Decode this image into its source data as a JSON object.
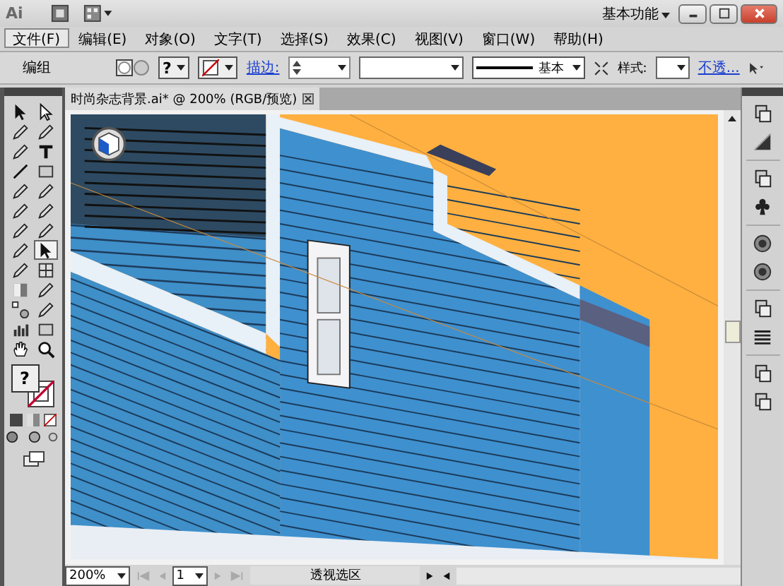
{
  "title_bar": {
    "app_logo": "Ai",
    "workspace": "基本功能"
  },
  "menu": [
    {
      "label": "文件(F)",
      "selected": true
    },
    {
      "label": "编辑(E)",
      "selected": false
    },
    {
      "label": "对象(O)",
      "selected": false
    },
    {
      "label": "文字(T)",
      "selected": false
    },
    {
      "label": "选择(S)",
      "selected": false
    },
    {
      "label": "效果(C)",
      "selected": false
    },
    {
      "label": "视图(V)",
      "selected": false
    },
    {
      "label": "窗口(W)",
      "selected": false
    },
    {
      "label": "帮助(H)",
      "selected": false
    }
  ],
  "control_bar": {
    "selection": "编组",
    "fill_symbol": "?",
    "stroke_link": "描边:",
    "stroke_profile": "基本",
    "style_label": "样式:",
    "opacity_link": "不透..."
  },
  "tools": [
    {
      "selected": false
    },
    {
      "selected": false
    },
    {
      "selected": false
    },
    {
      "selected": false
    },
    {
      "selected": false
    },
    {
      "selected": false
    },
    {
      "selected": false
    },
    {
      "selected": false
    },
    {
      "selected": false
    },
    {
      "selected": false
    },
    {
      "selected": false
    },
    {
      "selected": false
    },
    {
      "selected": false
    },
    {
      "selected": false
    },
    {
      "selected": false
    },
    {
      "selected": true
    },
    {
      "selected": false
    },
    {
      "selected": false
    },
    {
      "selected": false
    },
    {
      "selected": false
    },
    {
      "selected": false
    },
    {
      "selected": false
    },
    {
      "selected": false
    },
    {
      "selected": false
    },
    {
      "selected": false
    },
    {
      "selected": false
    }
  ],
  "color_well": {
    "fill_symbol": "?"
  },
  "document_tab": {
    "title": "时尚杂志背景.ai* @ 200% (RGB/预览)"
  },
  "status_bar": {
    "zoom": "200%",
    "page": "1",
    "current_tool": "透视选区"
  }
}
